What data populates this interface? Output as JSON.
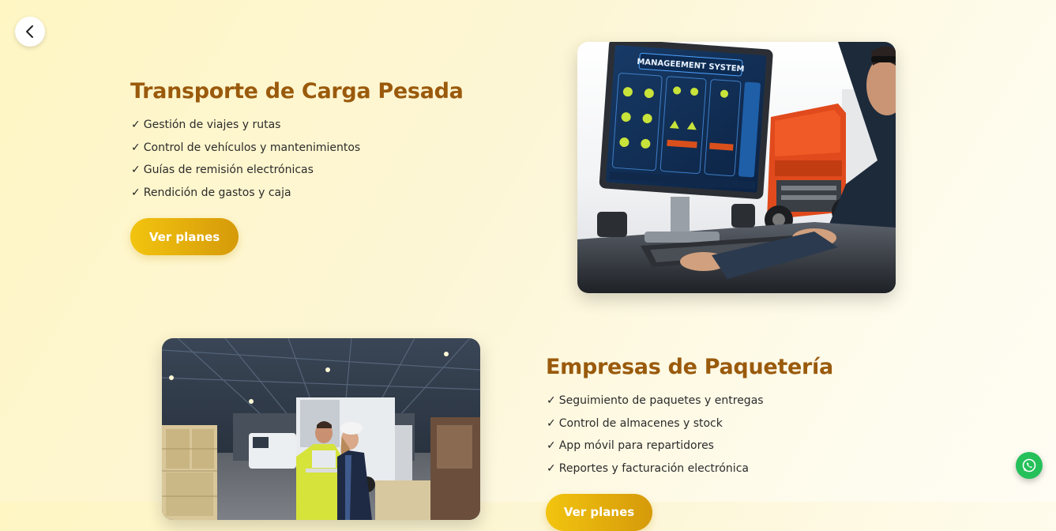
{
  "nav": {
    "back_icon": "chevron-left-icon"
  },
  "sections": [
    {
      "title": "Transporte de Carga Pesada",
      "features": [
        "Gestión de viajes y rutas",
        "Control de vehículos y mantenimientos",
        "Guías de remisión electrónicas",
        "Rendición de gastos y caja"
      ],
      "button_label": "Ver planes",
      "image": {
        "screen_title": "MANAGEEMENT SYSTEM",
        "depicts": "computer-monitor-truck-operator"
      }
    },
    {
      "title": "Empresas de Paquetería",
      "features": [
        "Seguimiento de paquetes y entregas",
        "Control de almacenes y stock",
        "App móvil para repartidores",
        "Reportes y facturación electrónica"
      ],
      "button_label": "Ver planes",
      "image": {
        "depicts": "warehouse-workers-with-truck"
      }
    }
  ],
  "check_mark": "✓",
  "floating": {
    "whatsapp_icon": "whatsapp-icon"
  },
  "colors": {
    "title": "#9a5a0c",
    "button_start": "#f2c40f",
    "button_end": "#d69a0a",
    "whatsapp": "#25c05a"
  }
}
